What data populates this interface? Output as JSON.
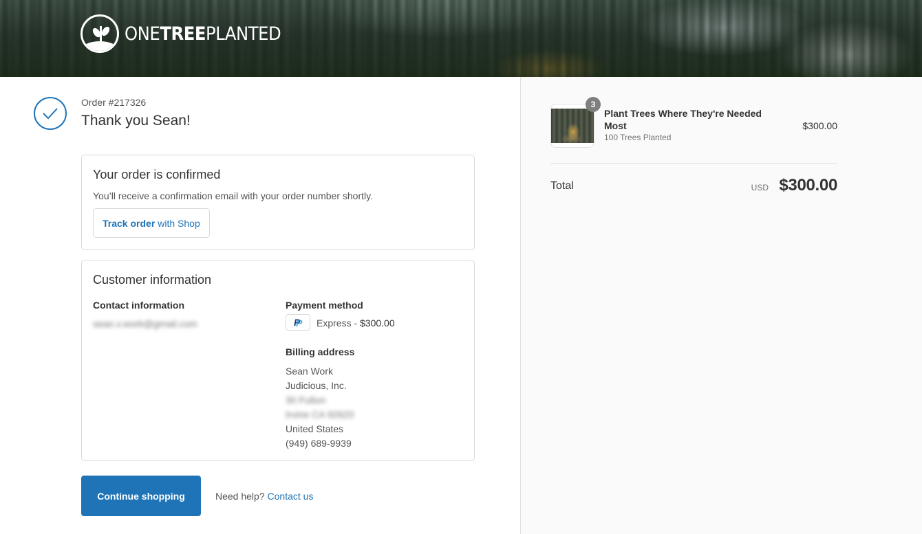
{
  "header": {
    "logo_text_light1": "ONE",
    "logo_text_bold": "TREE",
    "logo_text_light2": "PLANTED"
  },
  "order": {
    "number": "Order #217326",
    "thanks": "Thank you Sean!"
  },
  "confirmation": {
    "title": "Your order is confirmed",
    "description": "You’ll receive a confirmation email with your order number shortly.",
    "track_bold": "Track order",
    "track_rest": "with Shop"
  },
  "customer": {
    "title": "Customer information",
    "contact_label": "Contact information",
    "contact_email": "sean.v.work@gmail.com",
    "payment_label": "Payment method",
    "payment_icon": "paypal-icon",
    "payment_text": "Express - ",
    "payment_amount": "$300.00",
    "billing_label": "Billing address",
    "billing_lines": [
      "Sean Work",
      "Judicious, Inc.",
      "30 Fulton",
      "Irvine CA 92620",
      "United States",
      "(949) 689-9939"
    ]
  },
  "footer": {
    "continue_label": "Continue shopping",
    "help_text": "Need help?",
    "contact_link": "Contact us"
  },
  "summary": {
    "items": [
      {
        "quantity": "3",
        "name": "Plant Trees Where They're Needed Most",
        "variant": "100 Trees Planted",
        "price": "$300.00"
      }
    ],
    "total_label": "Total",
    "currency": "USD",
    "total": "$300.00"
  },
  "colors": {
    "accent": "#1f74b8",
    "sidebar_bg": "#fafafa",
    "border": "#d9d9d9"
  }
}
